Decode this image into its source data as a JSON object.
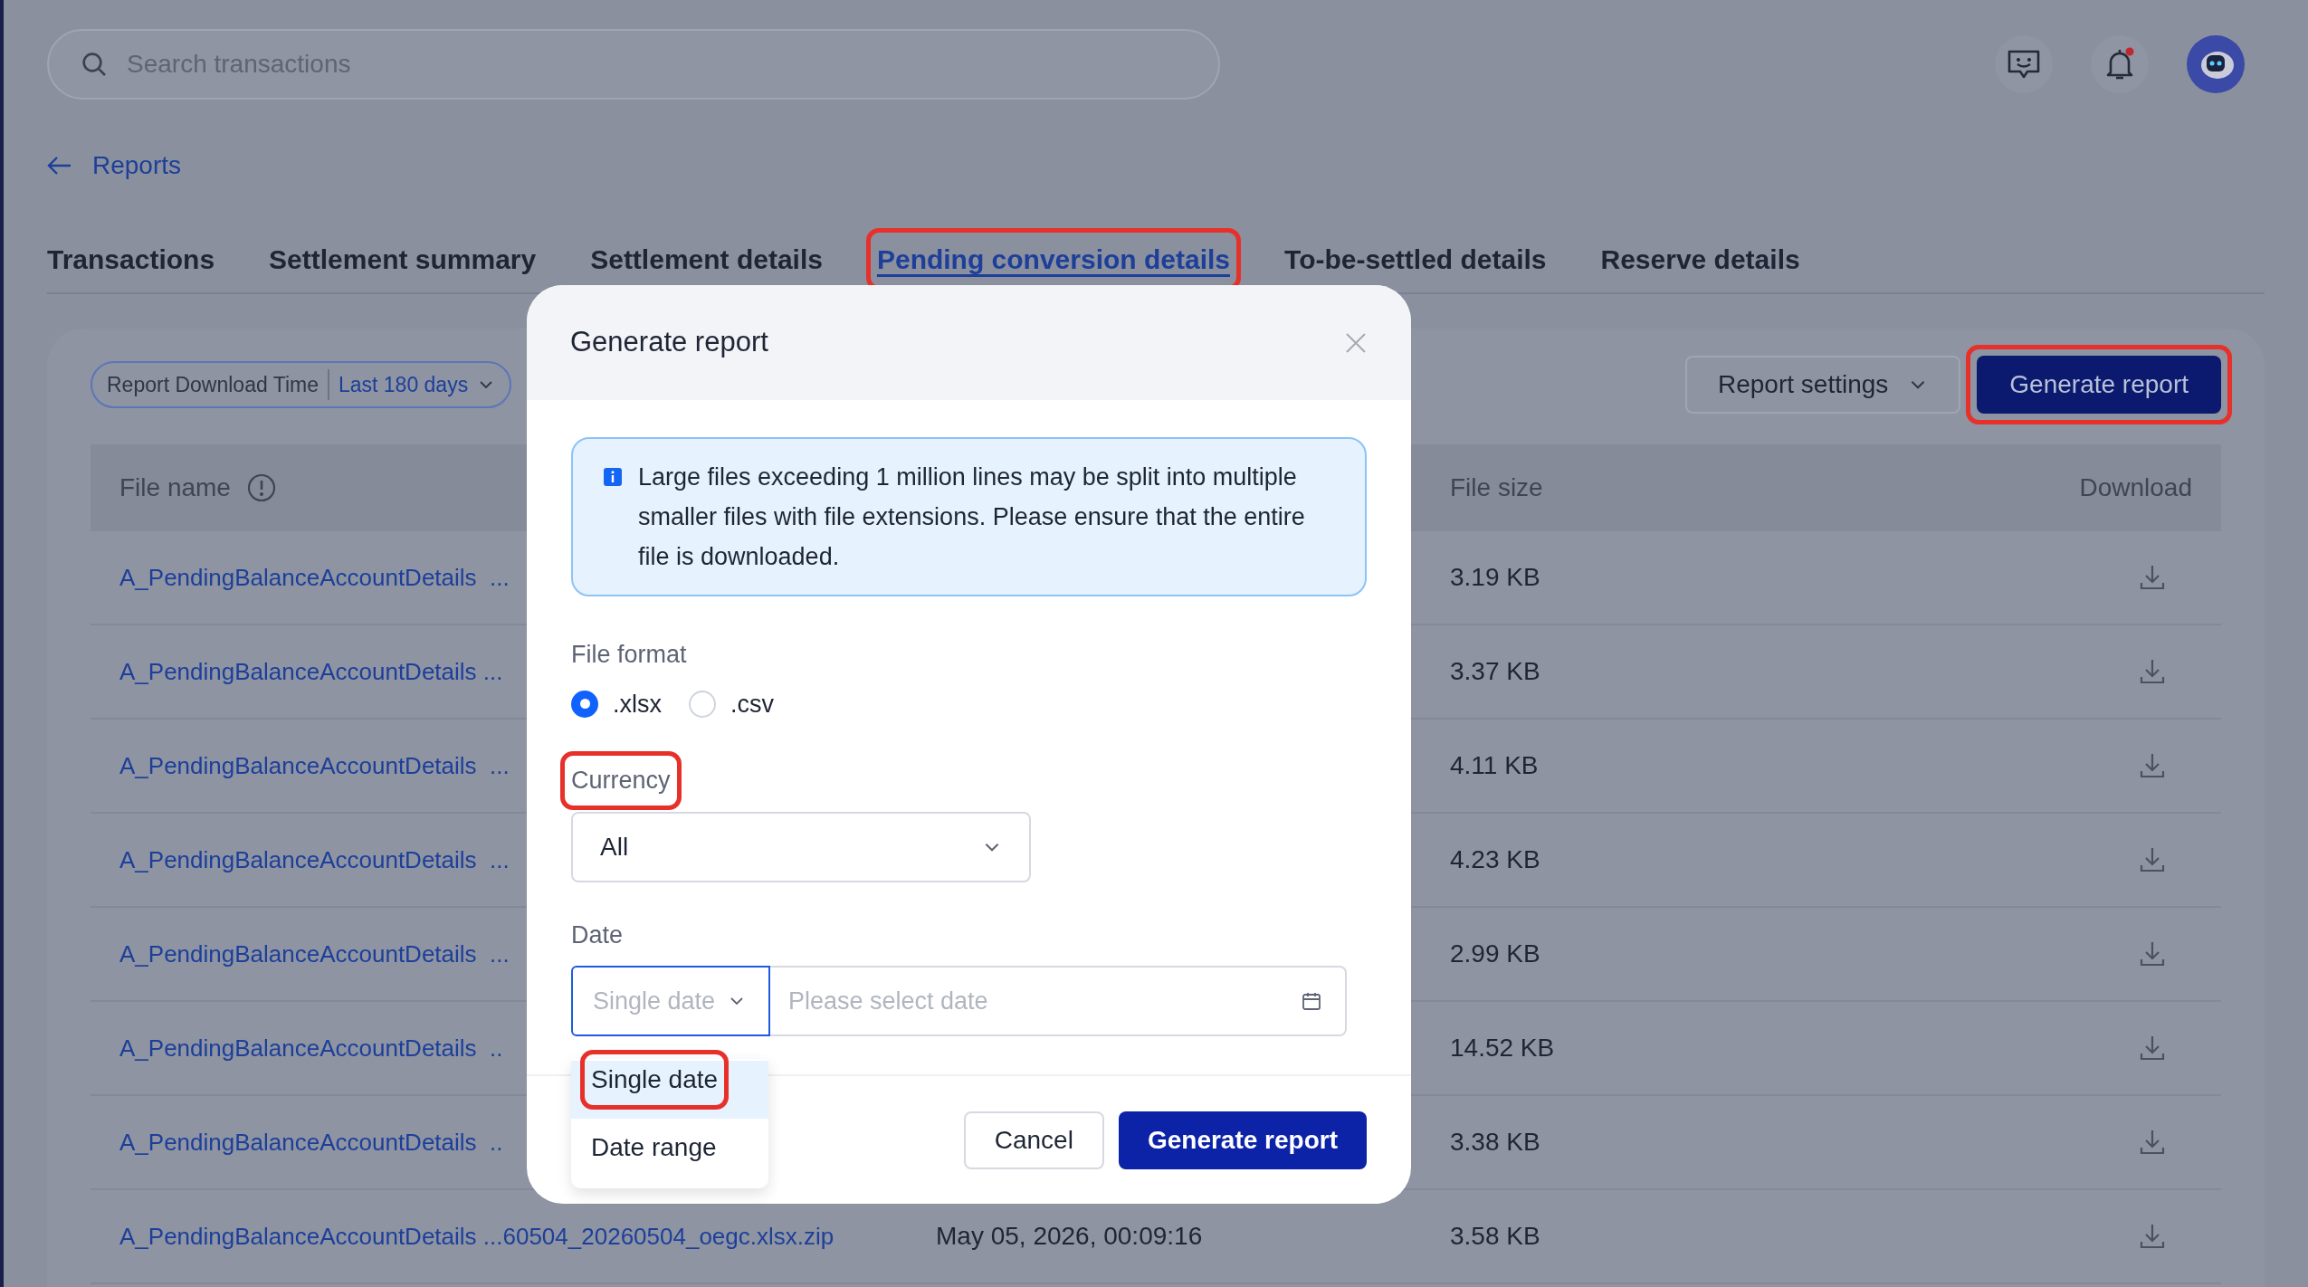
{
  "search": {
    "placeholder": "Search transactions"
  },
  "back_link": "Reports",
  "tabs": [
    {
      "label": "Transactions",
      "selected": false,
      "highlighted": false
    },
    {
      "label": "Settlement summary",
      "selected": false,
      "highlighted": false
    },
    {
      "label": "Settlement details",
      "selected": false,
      "highlighted": false
    },
    {
      "label": "Pending conversion details",
      "selected": true,
      "highlighted": true
    },
    {
      "label": "To-be-settled details",
      "selected": false,
      "highlighted": false
    },
    {
      "label": "Reserve details",
      "selected": false,
      "highlighted": false
    }
  ],
  "filter": {
    "label": "Report Download Time",
    "value": "Last 180 days"
  },
  "toolbar": [
    {
      "label": "Report settings",
      "kind": "dropdown",
      "highlighted": false
    },
    {
      "label": "Generate report",
      "kind": "primary",
      "highlighted": true
    }
  ],
  "table": {
    "columns": [
      {
        "label": "File name",
        "kind": "info"
      },
      {
        "label": "File size",
        "kind": "plain"
      },
      {
        "label": "Download",
        "kind": "right"
      }
    ],
    "rows": [
      {
        "file_name": "A_PendingBalanceAccountDetails  ...",
        "file_size": "3.19 KB"
      },
      {
        "file_name": "A_PendingBalanceAccountDetails ...",
        "file_size": "3.37 KB"
      },
      {
        "file_name": "A_PendingBalanceAccountDetails  ...",
        "file_size": "4.11 KB"
      },
      {
        "file_name": "A_PendingBalanceAccountDetails  ...",
        "file_size": "4.23 KB"
      },
      {
        "file_name": "A_PendingBalanceAccountDetails  ...",
        "file_size": "2.99 KB"
      },
      {
        "file_name": "A_PendingBalanceAccountDetails  ..",
        "file_size": "14.52 KB"
      },
      {
        "file_name": "A_PendingBalanceAccountDetails  ..",
        "file_size": "3.38 KB"
      },
      {
        "file_name": "A_PendingBalanceAccountDetails ...60504_20260504_oegc.xlsx.zip",
        "created": "May 05, 2026, 00:09:16",
        "file_size": "3.58 KB"
      }
    ]
  },
  "modal": {
    "title": "Generate report",
    "notice": "Large files exceeding 1 million lines may be split into multiple smaller files with file extensions. Please ensure that the entire file is downloaded.",
    "file_format": {
      "label": "File format",
      "options": [
        {
          "label": ".xlsx",
          "selected": true
        },
        {
          "label": ".csv",
          "selected": false
        }
      ]
    },
    "currency": {
      "label": "Currency",
      "value": "All",
      "highlighted": true
    },
    "date": {
      "label": "Date",
      "mode_placeholder": "Single date",
      "input_placeholder": "Please select date",
      "options": [
        {
          "label": "Single date",
          "selected": true,
          "highlighted": true
        },
        {
          "label": "Date range",
          "selected": false,
          "highlighted": false
        }
      ]
    },
    "buttons": [
      {
        "label": "Cancel",
        "kind": "secondary"
      },
      {
        "label": "Generate report",
        "kind": "primary"
      }
    ]
  }
}
